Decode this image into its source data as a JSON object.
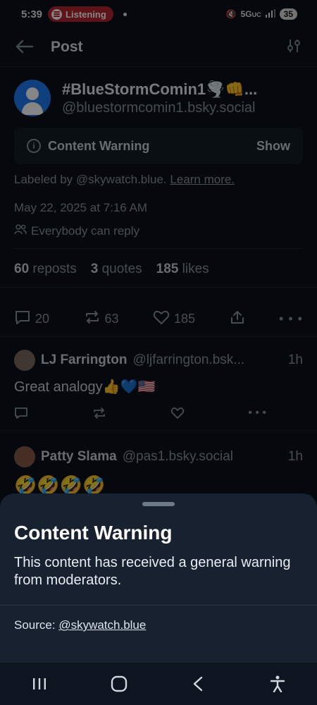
{
  "status": {
    "time": "5:39",
    "listening": "Listening",
    "network": "5G",
    "network_sub": "UC",
    "battery": "35"
  },
  "header": {
    "title": "Post",
    "back_icon": "arrow-left-icon",
    "filter_icon": "sliders-icon"
  },
  "post": {
    "display_name": "#BlueStormComin1🌪️👊...",
    "handle": "@bluestormcomin1.bsky.social",
    "content_warning_label": "Content Warning",
    "show_label": "Show",
    "labeled_prefix": "Labeled by @skywatch.blue.",
    "learn_more": "Learn more.",
    "date": "May 22, 2025 at 7:16 AM",
    "reply_setting": "Everybody can reply",
    "reposts_count": "60",
    "reposts_label": "reposts",
    "quotes_count": "3",
    "quotes_label": "quotes",
    "likes_count": "185",
    "likes_label": "likes",
    "actions": {
      "replies": "20",
      "reposts": "63",
      "likes": "185"
    }
  },
  "replies": [
    {
      "name": "LJ Farrington",
      "handle": "@ljfarrington.bsk...",
      "time": "1h",
      "text": "Great analogy👍💙🇺🇸"
    },
    {
      "name": "Patty Slama",
      "handle": "@pas1.bsky.social",
      "time": "1h",
      "text": "🤣🤣🤣🤣"
    }
  ],
  "sheet": {
    "title": "Content Warning",
    "description": "This content has received a general warning from moderators.",
    "source_prefix": "Source: ",
    "source_link": "@skywatch.blue"
  }
}
